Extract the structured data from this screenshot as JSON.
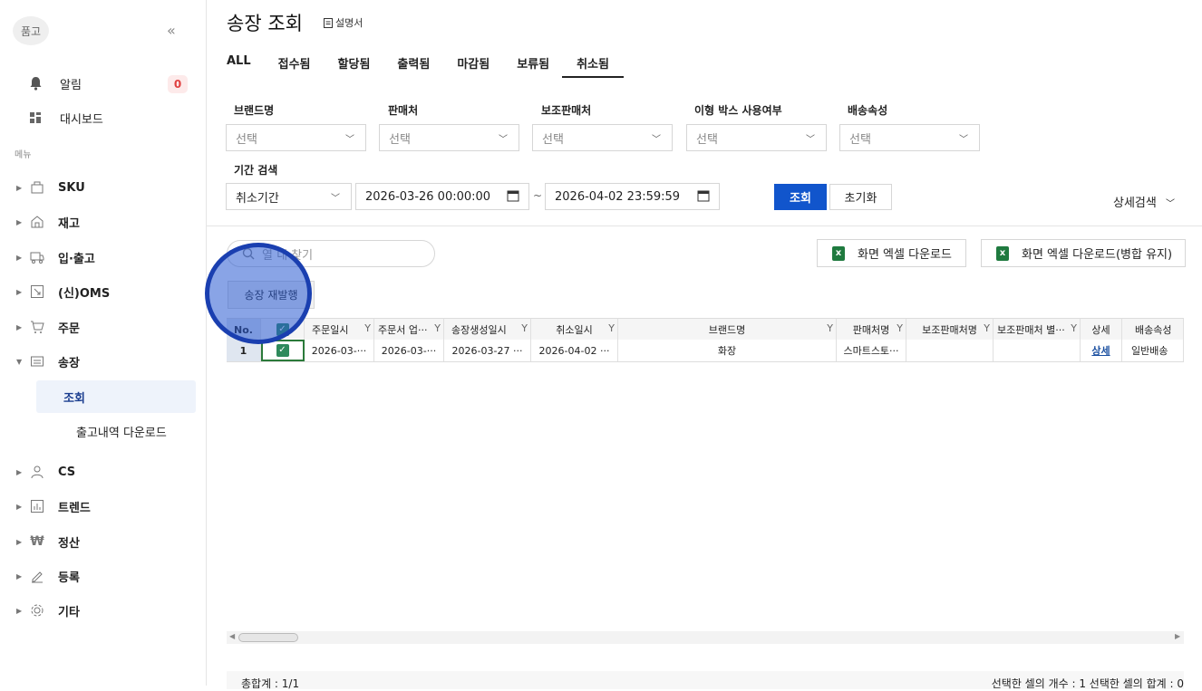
{
  "sidebar": {
    "logo": "품고",
    "collapse": "«",
    "alert_label": "알림",
    "alert_count": "0",
    "dashboard_label": "대시보드",
    "menu_caption": "메뉴",
    "tree": [
      {
        "label": "SKU"
      },
      {
        "label": "재고"
      },
      {
        "label": "입·출고"
      },
      {
        "label": "(신)OMS"
      },
      {
        "label": "주문"
      },
      {
        "label": "송장"
      }
    ],
    "sub_items": [
      "조회",
      "출고내역 다운로드"
    ],
    "tree2": [
      {
        "label": "CS"
      },
      {
        "label": "트렌드"
      },
      {
        "label": "정산"
      },
      {
        "label": "등록"
      },
      {
        "label": "기타"
      }
    ]
  },
  "header": {
    "title": "송장 조회",
    "manual": "설명서"
  },
  "tabs": [
    "ALL",
    "접수됨",
    "할당됨",
    "출력됨",
    "마감됨",
    "보류됨",
    "취소됨"
  ],
  "filters": {
    "brand_label": "브랜드명",
    "seller_label": "판매처",
    "sub_seller_label": "보조판매처",
    "box_label": "이형 박스 사용여부",
    "ship_label": "배송속성",
    "placeholder": "선택",
    "period_label": "기간 검색",
    "period_type": "취소기간",
    "date_from": "2026-03-26 00:00:00",
    "tilde": "~",
    "date_to": "2026-04-02 23:59:59",
    "search_button": "조회",
    "reset_button": "초기화",
    "detail_search": "상세검색"
  },
  "toolbar": {
    "search_placeholder": "열 내 찾기",
    "excel_download": "화면 엑셀 다운로드",
    "excel_download_merge": "화면 엑셀 다운로드(병합 유지)",
    "reissue": "송장 재발행"
  },
  "grid": {
    "headers": [
      "No.",
      "",
      "주문일시",
      "주문서 업···",
      "송장생성일시",
      "취소일시",
      "브랜드명",
      "판매처명",
      "보조판매처명",
      "보조판매처 별···",
      "상세",
      "배송속성"
    ],
    "row": [
      "1",
      "",
      "2026-03-···",
      "2026-03-···",
      "2026-03-27 ···",
      "2026-04-02 ···",
      "화장",
      "스마트스토···",
      "",
      "",
      "상세",
      "일반배송"
    ]
  },
  "footer": {
    "total": "총합계 : 1/1",
    "selection": "선택한 셀의 개수 : 1  선택한 셀의 합계 : 0"
  },
  "colors": {
    "primary": "#1155cc",
    "badge": "#e04040",
    "excel": "#1f7a3f"
  }
}
